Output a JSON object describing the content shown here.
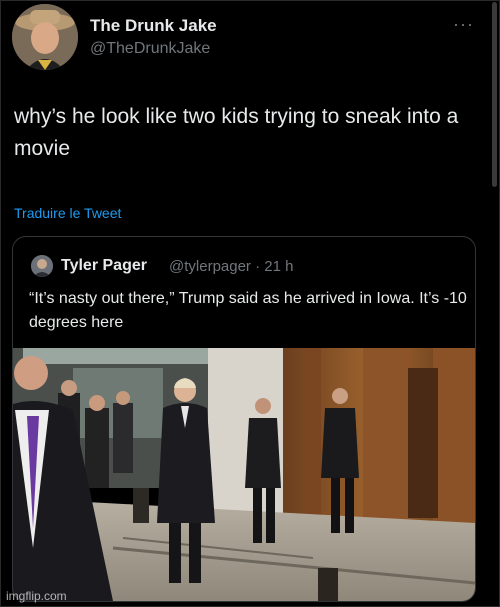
{
  "tweet": {
    "display_name": "The Drunk Jake",
    "handle": "@TheDrunkJake",
    "more_icon": "more-icon",
    "text": "why’s he look like two kids trying to sneak into a movie",
    "translate_label": "Traduire le Tweet"
  },
  "quoted_tweet": {
    "display_name": "Tyler Pager",
    "handle_time": "@tylerpager · 21 h",
    "text": "“It’s nasty out there,” Trump said as he arrived in Iowa. It’s -10 degrees here"
  },
  "watermark": "imgflip.com",
  "colors": {
    "background": "#000000",
    "text": "#e7e9ea",
    "secondary": "#71767b",
    "link": "#1d9bf0",
    "border": "#333639"
  }
}
